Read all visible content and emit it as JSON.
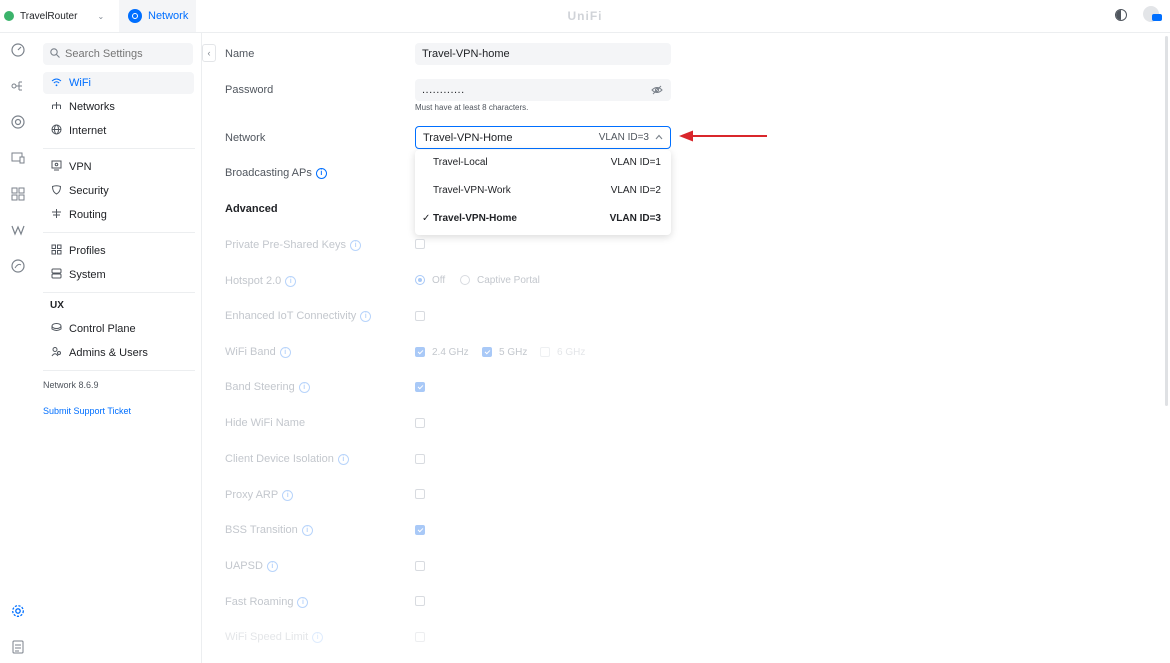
{
  "topbar": {
    "site_name": "TravelRouter",
    "site_caret": "⌄",
    "app_name": "Network",
    "brand": "UniFi"
  },
  "sidebar": {
    "search_placeholder": "Search Settings",
    "items": [
      {
        "label": "WiFi",
        "icon": "wifi-icon",
        "active": true
      },
      {
        "label": "Networks",
        "icon": "networks-icon"
      },
      {
        "label": "Internet",
        "icon": "globe-icon"
      },
      {
        "label": "VPN",
        "icon": "vpn-icon"
      },
      {
        "label": "Security",
        "icon": "shield-icon"
      },
      {
        "label": "Routing",
        "icon": "routing-icon"
      },
      {
        "label": "Profiles",
        "icon": "profiles-icon"
      },
      {
        "label": "System",
        "icon": "system-icon"
      },
      {
        "label": "Control Plane",
        "icon": "control-plane-icon"
      },
      {
        "label": "Admins & Users",
        "icon": "users-icon"
      }
    ],
    "ux_heading": "UX",
    "version": "Network 8.6.9",
    "support_link": "Submit Support Ticket"
  },
  "form": {
    "name_label": "Name",
    "name_value": "Travel-VPN-home",
    "password_label": "Password",
    "password_value": "............",
    "password_hint": "Must have at least 8 characters.",
    "network_label": "Network",
    "network_selected": "Travel-VPN-Home",
    "network_selected_vlan": "VLAN ID=3",
    "network_options": [
      {
        "name": "Travel-Local",
        "vlan": "VLAN ID=1"
      },
      {
        "name": "Travel-VPN-Work",
        "vlan": "VLAN ID=2"
      },
      {
        "name": "Travel-VPN-Home",
        "vlan": "VLAN ID=3",
        "selected": true
      }
    ],
    "broadcasting_label": "Broadcasting APs",
    "advanced_label": "Advanced",
    "ppsk_label": "Private Pre-Shared Keys",
    "hotspot_label": "Hotspot 2.0",
    "hotspot_off": "Off",
    "hotspot_captive": "Captive Portal",
    "iot_label": "Enhanced IoT Connectivity",
    "band_label": "WiFi Band",
    "band_24": "2.4 GHz",
    "band_5": "5 GHz",
    "band_6": "6 GHz",
    "band_steering_label": "Band Steering",
    "hide_name_label": "Hide WiFi Name",
    "isolation_label": "Client Device Isolation",
    "proxy_arp_label": "Proxy ARP",
    "bss_label": "BSS Transition",
    "uapsd_label": "UAPSD",
    "fast_roaming_label": "Fast Roaming",
    "speed_limit_label": "WiFi Speed Limit"
  },
  "colors": {
    "accent": "#006fff",
    "annotation_arrow": "#d9262b"
  }
}
